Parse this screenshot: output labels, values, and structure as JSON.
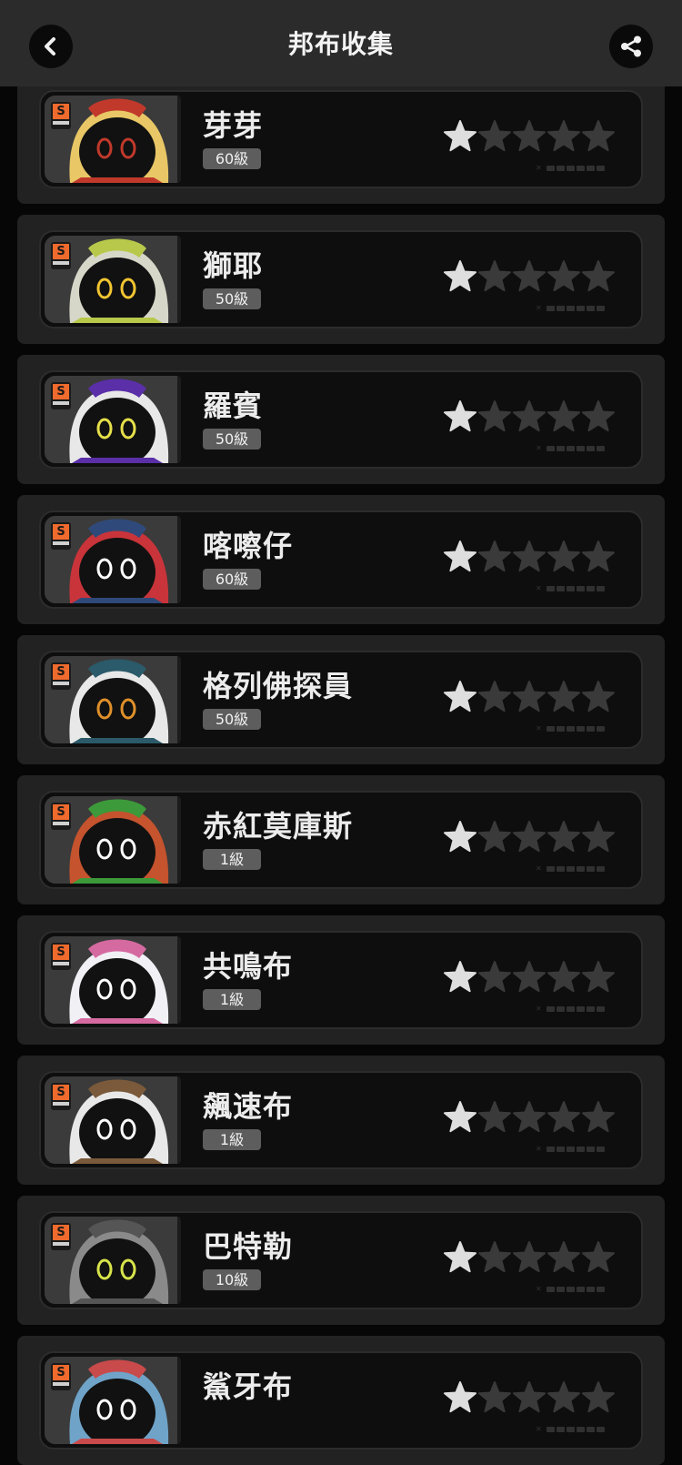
{
  "header": {
    "title": "邦布收集",
    "back_icon": "chevron-left-icon",
    "share_icon": "share-icon"
  },
  "rank_label": "S",
  "max_stars": 5,
  "bangboos": [
    {
      "name": "芽芽",
      "level": "60級",
      "stars": 1,
      "colors": {
        "hair": "#e9c766",
        "accent": "#c0392b",
        "eye": "#c0392b"
      }
    },
    {
      "name": "獅耶",
      "level": "50級",
      "stars": 1,
      "colors": {
        "hair": "#d7d7c9",
        "accent": "#b8c84a",
        "eye": "#f2c531"
      }
    },
    {
      "name": "羅賓",
      "level": "50級",
      "stars": 1,
      "colors": {
        "hair": "#e8e8e8",
        "accent": "#5a2fa8",
        "eye": "#e6e04a"
      }
    },
    {
      "name": "喀嚓仔",
      "level": "60級",
      "stars": 1,
      "colors": {
        "hair": "#c8343a",
        "accent": "#2f4a7a",
        "eye": "#ffffff"
      }
    },
    {
      "name": "格列佛探員",
      "level": "50級",
      "stars": 1,
      "colors": {
        "hair": "#e8e8e8",
        "accent": "#2b5a6a",
        "eye": "#e0902a"
      }
    },
    {
      "name": "赤紅莫庫斯",
      "level": "1級",
      "stars": 1,
      "colors": {
        "hair": "#c4532e",
        "accent": "#3c9a3a",
        "eye": "#ffffff"
      }
    },
    {
      "name": "共鳴布",
      "level": "1級",
      "stars": 1,
      "colors": {
        "hair": "#f0f0f5",
        "accent": "#d56aa0",
        "eye": "#ffffff"
      }
    },
    {
      "name": "飆速布",
      "level": "1級",
      "stars": 1,
      "colors": {
        "hair": "#e8e8e8",
        "accent": "#7a5a3a",
        "eye": "#ffffff"
      }
    },
    {
      "name": "巴特勒",
      "level": "10級",
      "stars": 1,
      "colors": {
        "hair": "#8a8a8a",
        "accent": "#555555",
        "eye": "#d8e44a"
      }
    },
    {
      "name": "鯊牙布",
      "level": "",
      "stars": 1,
      "colors": {
        "hair": "#6fa3c8",
        "accent": "#c84a4a",
        "eye": "#ffffff"
      }
    }
  ]
}
